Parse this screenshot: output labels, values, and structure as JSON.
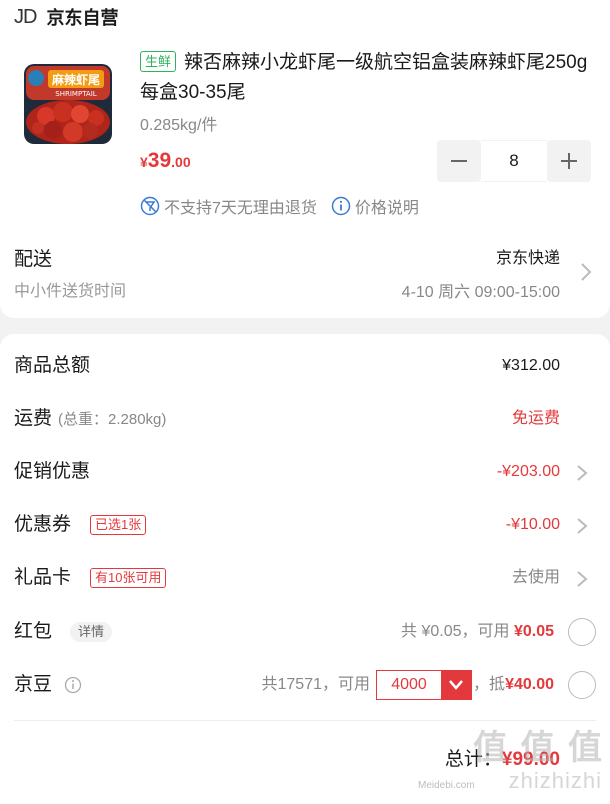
{
  "shop": {
    "logo": "JD",
    "name": "京东自营"
  },
  "product": {
    "tag": "生鲜",
    "title": "辣否麻辣小龙虾尾一级航空铝盒装麻辣虾尾250g每盒30-35尾",
    "unit_weight": "0.285kg/件",
    "price_symbol": "¥",
    "price_int": "39",
    "price_dec": ".00",
    "image_label": "麻辣虾尾",
    "image_sublabel": "SHRIMPTAIL"
  },
  "stepper": {
    "minus": "−",
    "value": "8",
    "plus": "+"
  },
  "policy": {
    "no_return": "不支持7天无理由退货",
    "price_note": "价格说明"
  },
  "shipping": {
    "label": "配送",
    "method": "京东快递",
    "sub": "中小件送货时间",
    "time": "4-10 周六 09:00-15:00"
  },
  "summary": {
    "goods_total_label": "商品总额",
    "goods_total_value": "¥312.00",
    "freight_label": "运费",
    "freight_note": "(总重：2.280kg)",
    "freight_value": "免运费",
    "promo_label": "促销优惠",
    "promo_value": "-¥203.00",
    "coupon_label": "优惠券",
    "coupon_badge": "已选1张",
    "coupon_value": "-¥10.00",
    "giftcard_label": "礼品卡",
    "giftcard_badge": "有10张可用",
    "giftcard_value": "去使用",
    "redpacket_label": "红包",
    "redpacket_badge": "详情",
    "redpacket_total": "共 ¥0.05，可用",
    "redpacket_value": "¥0.05",
    "bean_label": "京豆",
    "bean_total": "共17571，可用",
    "bean_selected": "4000",
    "bean_deduct_prefix": "，抵",
    "bean_deduct_value": "¥40.00",
    "total_label": "总计：",
    "total_value": "¥99.00"
  },
  "watermark": {
    "main": "值 值 值",
    "sub": "zhizhizhi",
    "small": "Meidebi.com"
  },
  "colors": {
    "accent": "#e4393c",
    "fresh": "#2fb35c"
  }
}
